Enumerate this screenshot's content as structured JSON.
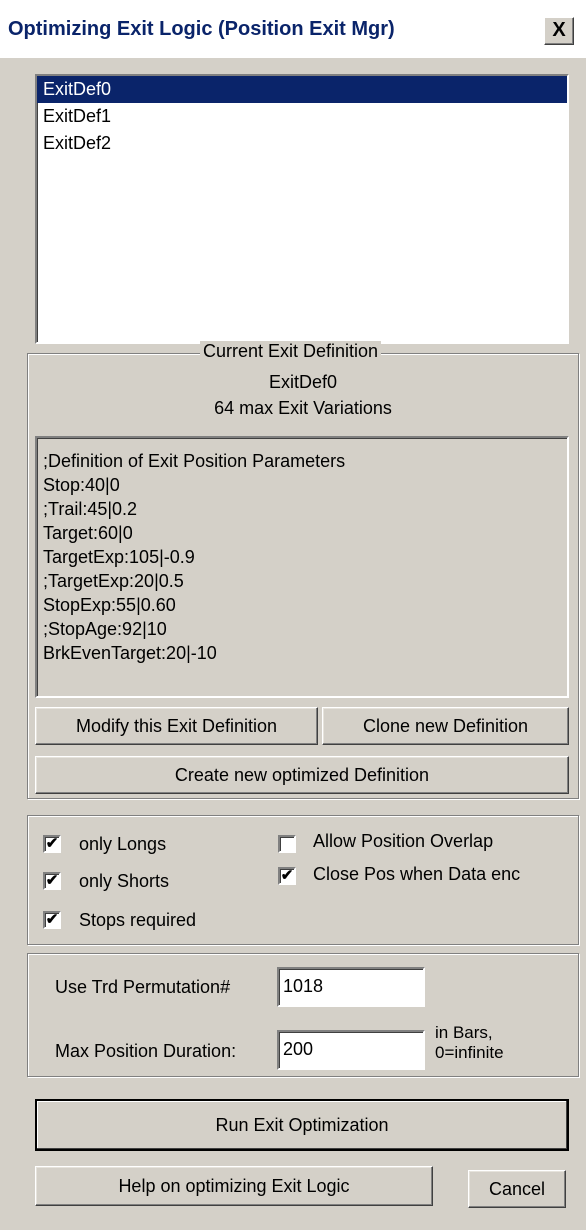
{
  "window": {
    "title": "Optimizing Exit Logic (Position Exit Mgr)",
    "close_glyph": "X"
  },
  "exit_list": {
    "items": [
      "ExitDef0",
      "ExitDef1",
      "ExitDef2"
    ],
    "selected_index": 0
  },
  "current_def": {
    "group_label": "Current Exit Definition",
    "name": "ExitDef0",
    "variations": "64 max Exit Variations",
    "lines": [
      ";Definition of Exit Position Parameters",
      "Stop:40|0",
      ";Trail:45|0.2",
      "Target:60|0",
      "TargetExp:105|-0.9",
      ";TargetExp:20|0.5",
      "StopExp:55|0.60",
      ";StopAge:92|10",
      "BrkEvenTarget:20|-10"
    ],
    "modify_button": "Modify this Exit Definition",
    "clone_button": "Clone new Definition",
    "create_button": "Create new optimized Definition"
  },
  "options": {
    "only_longs": {
      "label": "only Longs",
      "checked": true
    },
    "only_shorts": {
      "label": "only Shorts",
      "checked": true
    },
    "stops_required": {
      "label": "Stops required",
      "checked": true
    },
    "allow_overlap": {
      "label": "Allow Position Overlap",
      "checked": false
    },
    "close_pos": {
      "label": "Close Pos when Data enc",
      "checked": true
    }
  },
  "params": {
    "permutation_label": "Use Trd Permutation#",
    "permutation_value": "1018",
    "duration_label": "Max Position Duration:",
    "duration_value": "200",
    "duration_unit_line1": "in Bars,",
    "duration_unit_line2": "0=infinite"
  },
  "footer": {
    "run_button": "Run Exit Optimization",
    "help_button": "Help on optimizing Exit Logic",
    "cancel_button": "Cancel"
  }
}
